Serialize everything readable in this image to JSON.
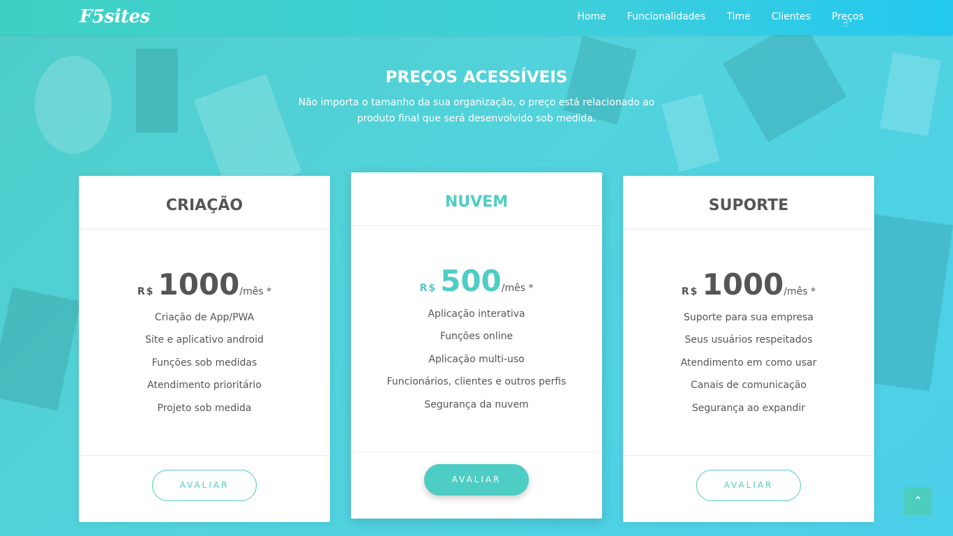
{
  "navbar": {
    "logo": "F5sites",
    "links": [
      "Home",
      "Funcionalidades",
      "Time",
      "Clientes",
      "Preços"
    ]
  },
  "section": {
    "title": "PREÇOS ACESSÍVEIS",
    "subtitle": "Não importa o tamanho da sua organização, o preço está relacionado ao produto final que será desenvolvido sob medida."
  },
  "plans": [
    {
      "name": "CRIAÇÃO",
      "currency": "R$",
      "amount": "1000",
      "period": "/mês *",
      "features": [
        "Criação de App/PWA",
        "Site e aplicativo android",
        "Funções sob medidas",
        "Atendimento prioritário",
        "Projeto sob medida"
      ],
      "button": "AVALIAR"
    },
    {
      "name": "NUVEM",
      "currency": "R$",
      "amount": "500",
      "period": "/mês *",
      "features": [
        "Aplicação interativa",
        "Funções online",
        "Aplicação multi-uso",
        "Funcionários, clientes e outros perfis",
        "Segurança da nuvem"
      ],
      "button": "AVALIAR"
    },
    {
      "name": "SUPORTE",
      "currency": "R$",
      "amount": "1000",
      "period": "/mês *",
      "features": [
        "Suporte para sua empresa",
        "Seus usuários respeitados",
        "Atendimento em como usar",
        "Canais de comunicação",
        "Segurança ao expandir"
      ],
      "button": "AVALIAR"
    }
  ],
  "colors": {
    "accent": "#4ecdc4",
    "text": "#555555",
    "nav_gradient_end": "#22c8f0"
  },
  "icons": {
    "back_to_top": "chevron-up-icon",
    "cursor": "hand-pointer-icon"
  }
}
